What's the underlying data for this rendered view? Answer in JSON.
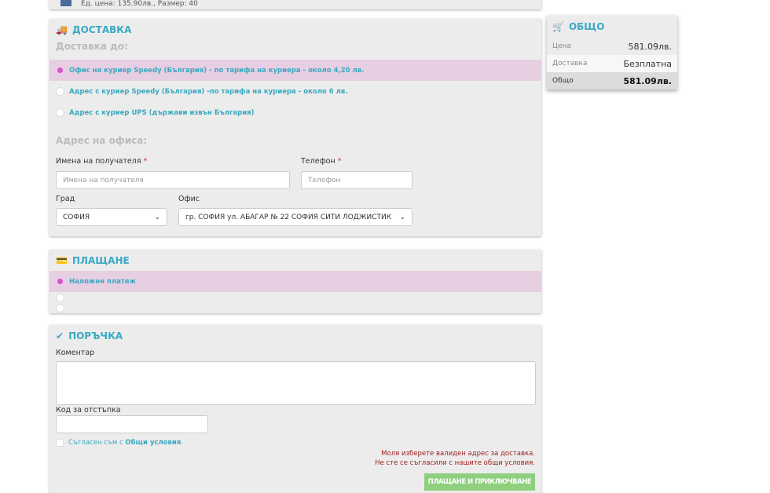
{
  "top_item": {
    "text": "Ед. цена: 135.90лв., Размер: 40"
  },
  "delivery": {
    "title": "ДОСТАВКА",
    "subtitle": "Доставка до:",
    "options": [
      "Офис на куриер Speedy (България) - по тарифа на куриера - около 4,20 лв.",
      "Адрес с куриер Speedy (България) -по тарифа на куриера - около 6 лв.",
      "Адрес с куриер UPS (държави извън България)"
    ],
    "office_subtitle": "Адрес на офиса:",
    "name_label": "Имена на получателя",
    "name_placeholder": "Имена на получателя",
    "phone_label": "Телефон",
    "phone_placeholder": "Телефон",
    "required_mark": "*",
    "city_label": "Град",
    "city_value": "СОФИЯ",
    "office_label": "Офис",
    "office_value": "гр. СОФИЯ ул. АБАГАР № 22 СОФИЯ СИТИ ЛОДЖИСТИК"
  },
  "payment": {
    "title": "ПЛАЩАНЕ",
    "options": [
      "Наложен платеж"
    ]
  },
  "order": {
    "title": "ПОРЪЧКА",
    "comment_label": "Коментар",
    "discount_label": "Код за отстъпка",
    "agree_text": "Съгласен съм с ",
    "agree_link": "Общи условия",
    "agree_end": ".",
    "errors": [
      "Моля изберете валиден адрес за доставка.",
      "Не сте се съгласили с нашите общи условия."
    ],
    "submit": "ПЛАЩАНЕ И ПРИКЛЮЧВАНЕ"
  },
  "summary": {
    "title": "ОБЩО",
    "rows": [
      {
        "label": "Цена",
        "value": "581.09лв."
      },
      {
        "label": "Доставка",
        "value": "Безплатна"
      },
      {
        "label": "Общо",
        "value": "581.09лв."
      }
    ]
  }
}
